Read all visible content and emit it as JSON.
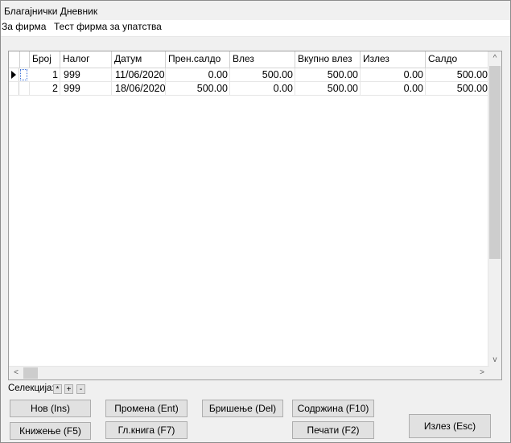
{
  "window": {
    "title": "Благајнички Дневник"
  },
  "firm": {
    "label": "За фирма",
    "name": "Тест фирма за упатства"
  },
  "grid": {
    "columns": [
      "Број",
      "Налог",
      "Датум",
      "Прен.салдо",
      "Влез",
      "Вкупно влез",
      "Излез",
      "Салдо"
    ],
    "rows": [
      {
        "broj": "1",
        "nalog": "999",
        "datum": "11/06/2020",
        "pren_saldo": "0.00",
        "vlez": "500.00",
        "vkupno_vlez": "500.00",
        "izlez": "0.00",
        "saldo": "500.00"
      },
      {
        "broj": "2",
        "nalog": "999",
        "datum": "18/06/2020",
        "pren_saldo": "500.00",
        "vlez": "0.00",
        "vkupno_vlez": "500.00",
        "izlez": "0.00",
        "saldo": "500.00"
      }
    ]
  },
  "selection": {
    "label": "Селекција:",
    "buttons": [
      "*",
      "+",
      "-"
    ]
  },
  "buttons": {
    "new": "Нов (Ins)",
    "change": "Промена (Ent)",
    "delete": "Бришење (Del)",
    "contents": "Содржина (F10)",
    "post": "Книжење (F5)",
    "ledger": "Гл.книга (F7)",
    "print": "Печати (F2)",
    "exit": "Излез (Esc)"
  },
  "icons": {
    "row_indicator": "current-row-arrow-icon"
  }
}
